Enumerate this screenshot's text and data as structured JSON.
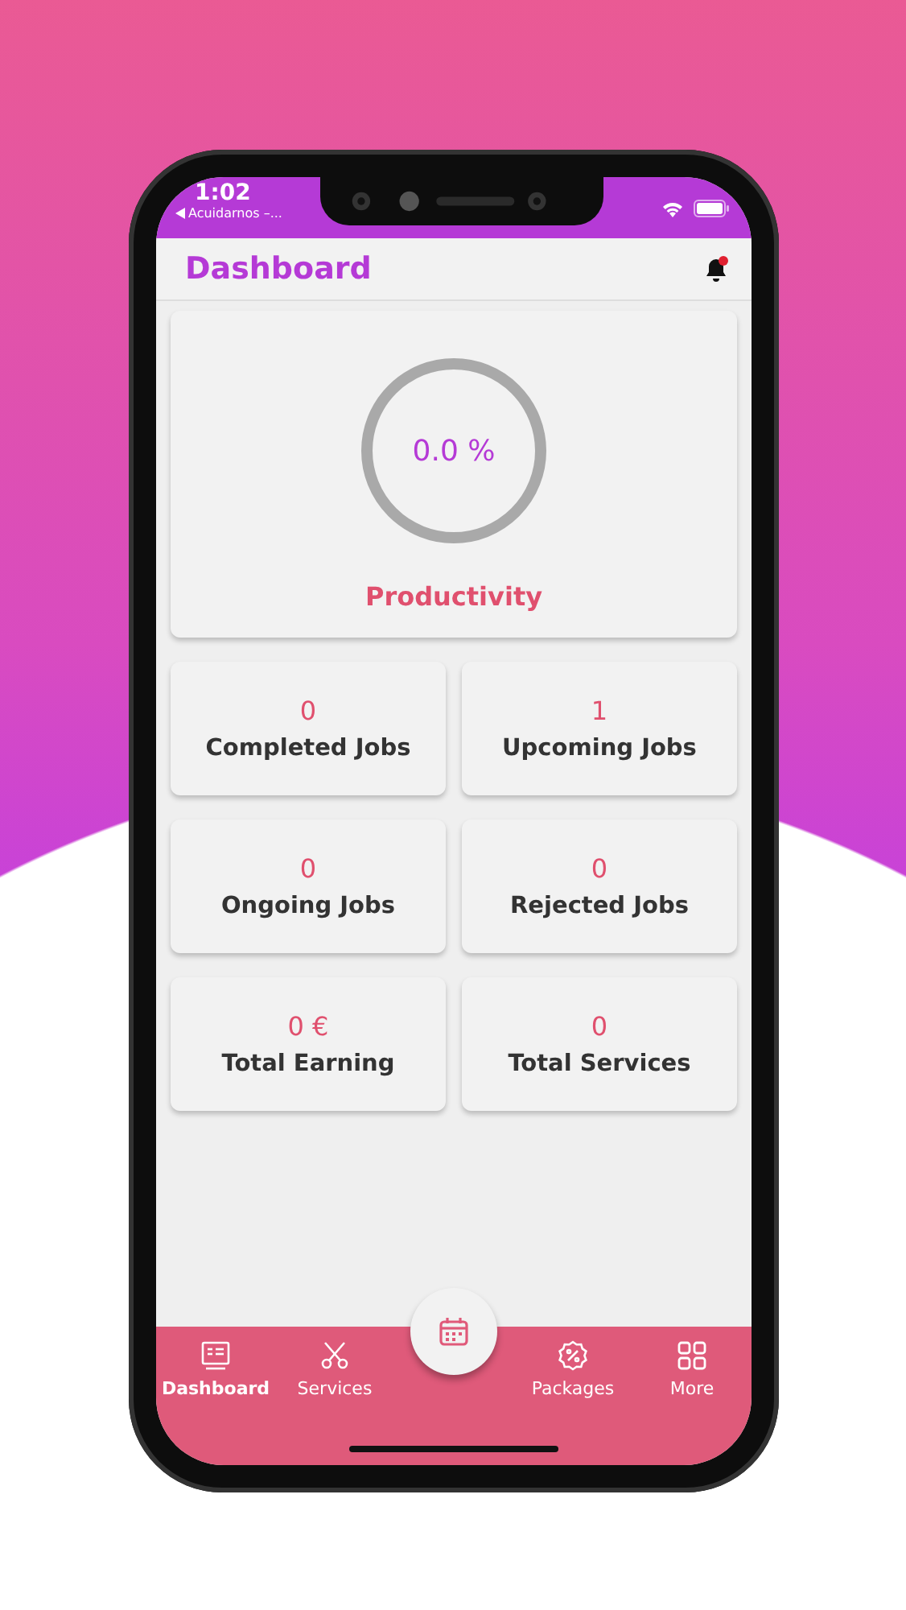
{
  "status_bar": {
    "time": "1:02",
    "back_label": "Acuidarnos –..."
  },
  "header": {
    "title": "Dashboard",
    "notification": {
      "unread": true
    }
  },
  "productivity": {
    "value": "0.0 %",
    "label": "Productivity"
  },
  "stats": [
    {
      "value": "0",
      "label": "Completed Jobs"
    },
    {
      "value": "1",
      "label": "Upcoming Jobs"
    },
    {
      "value": "0",
      "label": "Ongoing Jobs"
    },
    {
      "value": "0",
      "label": "Rejected Jobs"
    },
    {
      "value": "0 €",
      "label": "Total Earning"
    },
    {
      "value": "0",
      "label": "Total Services"
    }
  ],
  "bottom_nav": {
    "items": [
      {
        "kind": "dashboard",
        "label": "Dashboard",
        "selected": true
      },
      {
        "kind": "services",
        "label": "Services",
        "selected": false
      },
      {
        "kind": "calendar",
        "selected": false
      },
      {
        "kind": "packages",
        "label": "Packages",
        "selected": false
      },
      {
        "kind": "more",
        "label": "More",
        "selected": false
      }
    ]
  }
}
